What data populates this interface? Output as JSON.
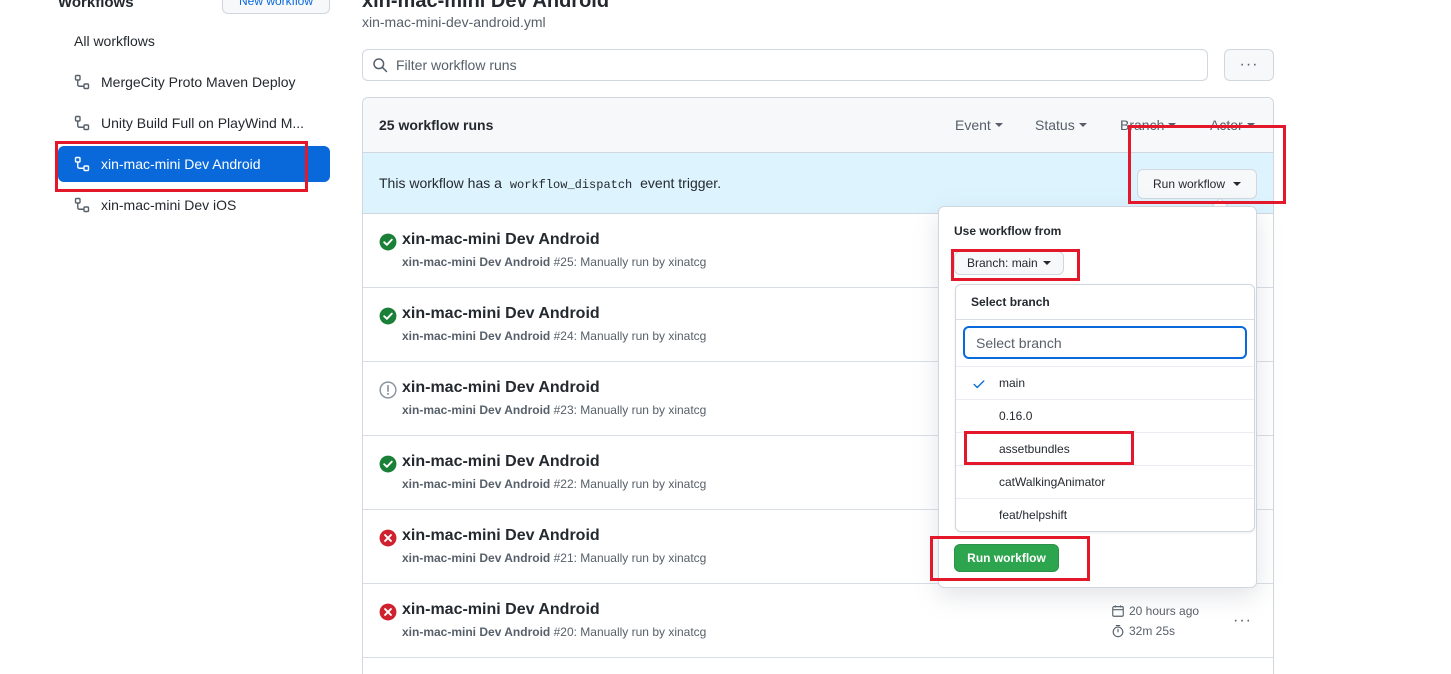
{
  "sidebar": {
    "heading": "Workflows",
    "new_workflow_label": "New workflow",
    "all_workflows_label": "All workflows",
    "items": [
      {
        "label": "MergeCity Proto Maven Deploy"
      },
      {
        "label": "Unity Build Full on PlayWind M..."
      },
      {
        "label": "xin-mac-mini Dev Android"
      },
      {
        "label": "xin-mac-mini Dev iOS"
      }
    ]
  },
  "header": {
    "title": "xin-mac-mini Dev Android",
    "filename": "xin-mac-mini-dev-android.yml",
    "filter_placeholder": "Filter workflow runs",
    "more_label": "···"
  },
  "runs": {
    "count_label": "25 workflow runs",
    "filters": {
      "event": "Event",
      "status": "Status",
      "branch": "Branch",
      "actor": "Actor"
    },
    "dispatch": {
      "prefix": "This workflow has a",
      "code": "workflow_dispatch",
      "suffix": "event trigger."
    },
    "run_workflow_label": "Run workflow",
    "rows": [
      {
        "status": "success",
        "title": "xin-mac-mini Dev Android",
        "workflow": "xin-mac-mini Dev Android",
        "detail": "#25: Manually run by xinatcg"
      },
      {
        "status": "success",
        "title": "xin-mac-mini Dev Android",
        "workflow": "xin-mac-mini Dev Android",
        "detail": "#24: Manually run by xinatcg"
      },
      {
        "status": "cancelled",
        "title": "xin-mac-mini Dev Android",
        "workflow": "xin-mac-mini Dev Android",
        "detail": "#23: Manually run by xinatcg"
      },
      {
        "status": "success",
        "title": "xin-mac-mini Dev Android",
        "workflow": "xin-mac-mini Dev Android",
        "detail": "#22: Manually run by xinatcg"
      },
      {
        "status": "failure",
        "title": "xin-mac-mini Dev Android",
        "workflow": "xin-mac-mini Dev Android",
        "detail": "#21: Manually run by xinatcg"
      },
      {
        "status": "failure",
        "title": "xin-mac-mini Dev Android",
        "workflow": "xin-mac-mini Dev Android",
        "detail": "#20: Manually run by xinatcg",
        "time_ago": "20 hours ago",
        "duration": "32m 25s"
      }
    ]
  },
  "popup": {
    "use_from_label": "Use workflow from",
    "branch_button_label": "Branch: main",
    "select_branch_title": "Select branch",
    "filter_placeholder": "Select branch",
    "branches": [
      "main",
      "0.16.0",
      "assetbundles",
      "catWalkingAnimator",
      "feat/helpshift"
    ],
    "selected_branch": "main",
    "submit_label": "Run workflow"
  },
  "colors": {
    "accent_blue": "#0969da",
    "success_green": "#1a7f37",
    "failure_red": "#cf222e",
    "annotation_red": "#e3192b",
    "button_green": "#2da44e",
    "dispatch_bg": "#ddf4ff"
  }
}
